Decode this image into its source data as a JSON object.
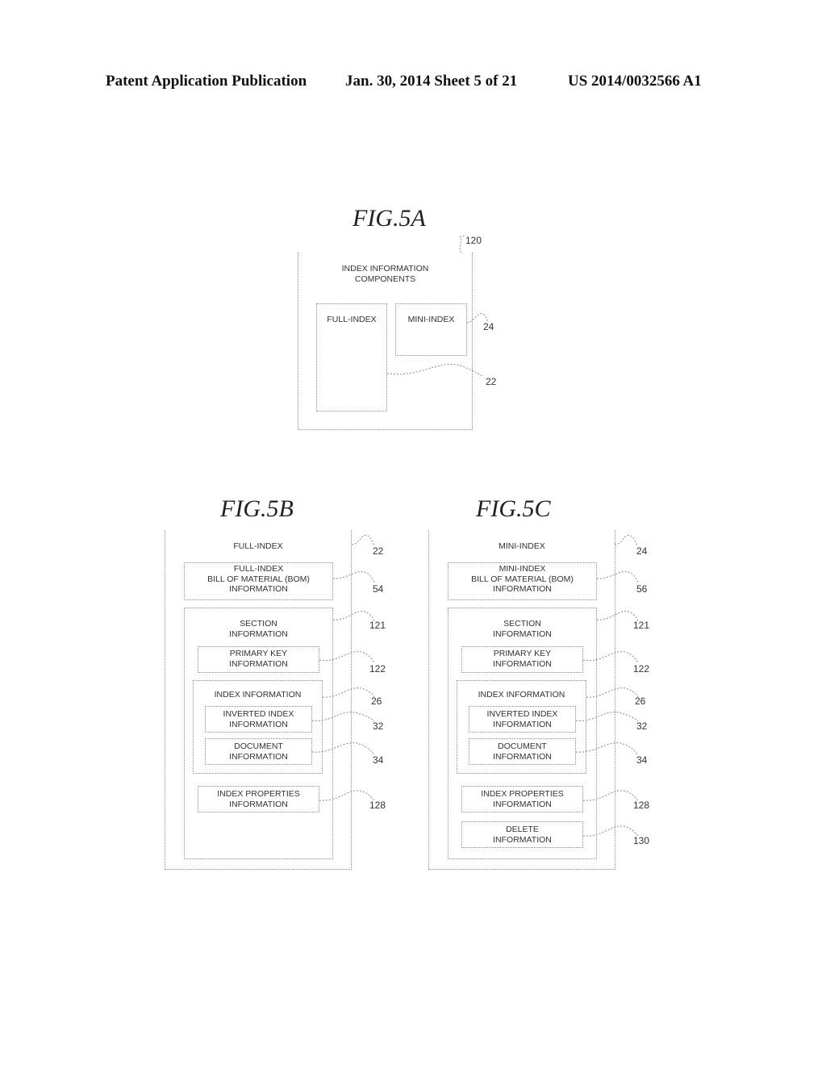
{
  "header": {
    "publication": "Patent Application Publication",
    "date_sheet": "Jan. 30, 2014   Sheet 5 of 21",
    "number": "US 2014/0032566 A1"
  },
  "fig5a": {
    "title": "FIG.5A",
    "outer_label": "INDEX INFORMATION\nCOMPONENTS",
    "outer_ref": "120",
    "full_index_label": "FULL-INDEX",
    "full_index_ref": "22",
    "mini_index_label": "MINI-INDEX",
    "mini_index_ref": "24"
  },
  "fig5b": {
    "title": "FIG.5B",
    "outer_label": "FULL-INDEX",
    "outer_ref": "22",
    "bom_label": "FULL-INDEX\nBILL OF MATERIAL (BOM)\nINFORMATION",
    "bom_ref": "54",
    "section_label": "SECTION\nINFORMATION",
    "section_ref": "121",
    "primary_key_label": "PRIMARY KEY\nINFORMATION",
    "primary_key_ref": "122",
    "index_info_label": "INDEX INFORMATION",
    "index_info_ref": "26",
    "inverted_label": "INVERTED INDEX\nINFORMATION",
    "inverted_ref": "32",
    "document_label": "DOCUMENT\nINFORMATION",
    "document_ref": "34",
    "properties_label": "INDEX PROPERTIES\nINFORMATION",
    "properties_ref": "128"
  },
  "fig5c": {
    "title": "FIG.5C",
    "outer_label": "MINI-INDEX",
    "outer_ref": "24",
    "bom_label": "MINI-INDEX\nBILL OF MATERIAL (BOM)\nINFORMATION",
    "bom_ref": "56",
    "section_label": "SECTION\nINFORMATION",
    "section_ref": "121",
    "primary_key_label": "PRIMARY KEY\nINFORMATION",
    "primary_key_ref": "122",
    "index_info_label": "INDEX INFORMATION",
    "index_info_ref": "26",
    "inverted_label": "INVERTED INDEX\nINFORMATION",
    "inverted_ref": "32",
    "document_label": "DOCUMENT\nINFORMATION",
    "document_ref": "34",
    "properties_label": "INDEX PROPERTIES\nINFORMATION",
    "properties_ref": "128",
    "delete_label": "DELETE\nINFORMATION",
    "delete_ref": "130"
  }
}
